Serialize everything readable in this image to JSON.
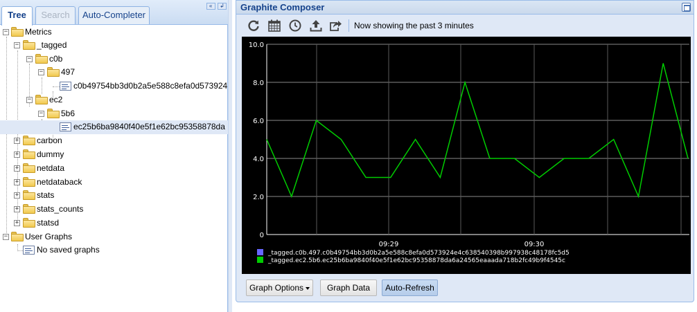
{
  "tabs": [
    {
      "label": "Tree"
    },
    {
      "label": "Search"
    },
    {
      "label": "Auto-Completer"
    }
  ],
  "tree": {
    "metrics": "Metrics",
    "tagged": "_tagged",
    "c0b": "c0b",
    "n497": "497",
    "leaf1": "c0b49754bb3d0b2a5e588c8efa0d573924",
    "ec2": "ec2",
    "n5b6": "5b6",
    "leaf2": "ec25b6ba9840f40e5f1e62bc95358878da",
    "carbon": "carbon",
    "dummy": "dummy",
    "netdata": "netdata",
    "netdataback": "netdataback",
    "stats": "stats",
    "stats_counts": "stats_counts",
    "statsd": "statsd",
    "user_graphs": "User Graphs",
    "no_saved": "No saved graphs"
  },
  "composer": {
    "title": "Graphite Composer",
    "status": "Now showing the past 3 minutes",
    "toolbar_icons": [
      "refresh-icon",
      "calendar-icon",
      "clock-icon",
      "upload-icon",
      "share-icon"
    ],
    "buttons": {
      "graph_options": "Graph Options",
      "graph_data": "Graph Data",
      "auto_refresh": "Auto-Refresh"
    }
  },
  "chart_data": {
    "type": "line",
    "ylim": [
      0,
      10
    ],
    "yticks": [
      "0",
      "2.0",
      "4.0",
      "6.0",
      "8.0",
      "10.0"
    ],
    "xticks": [
      "09:29",
      "09:30"
    ],
    "grid": true,
    "legend_placement": "bottom-left",
    "series": [
      {
        "name": "_tagged.c0b.497.c0b49754bb3d0b2a5e588c8efa0d573924e4c638540398b997938c48178fc5d5",
        "color": "#6666ff",
        "values": []
      },
      {
        "name": "_tagged.ec2.5b6.ec25b6ba9840f40e5f1e62bc95358878da6a24565eaaada718b2fc49b9f4545c",
        "color": "#00cc00",
        "values": [
          5,
          2,
          6,
          5,
          3,
          3,
          5,
          3,
          8,
          4,
          4,
          3,
          4,
          4,
          5,
          2,
          9,
          4
        ]
      }
    ]
  }
}
